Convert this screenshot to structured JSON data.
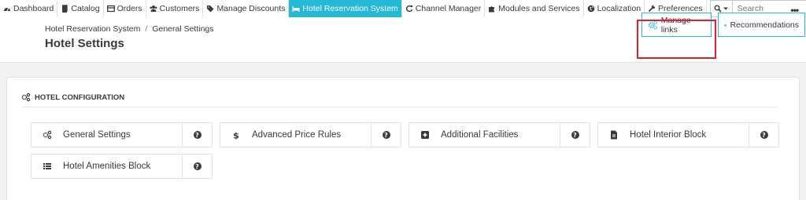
{
  "nav": {
    "items": [
      {
        "label": "Dashboard",
        "icon": "dashboard-icon"
      },
      {
        "label": "Catalog",
        "icon": "book-icon"
      },
      {
        "label": "Orders",
        "icon": "orders-icon"
      },
      {
        "label": "Customers",
        "icon": "users-icon"
      },
      {
        "label": "Manage Discounts",
        "icon": "tag-icon"
      },
      {
        "label": "Hotel Reservation System",
        "icon": "bed-icon",
        "active": true
      },
      {
        "label": "Channel Manager",
        "icon": "refresh-icon"
      },
      {
        "label": "Modules and Services",
        "icon": "puzzle-icon"
      },
      {
        "label": "Localization",
        "icon": "globe-icon"
      },
      {
        "label": "Preferences",
        "icon": "wrench-icon"
      }
    ],
    "search_placeholder": "Search",
    "more_label": "•••"
  },
  "header": {
    "breadcrumb": [
      "Hotel Reservation System",
      "General Settings"
    ],
    "breadcrumb_separator": "/",
    "title": "Hotel Settings",
    "manage_links_label": "Manage links",
    "recommendations_label": "Recommendations"
  },
  "panel": {
    "heading": "HOTEL CONFIGURATION",
    "tiles": [
      {
        "label": "General Settings",
        "icon": "cogs-icon",
        "help": "?"
      },
      {
        "label": "Advanced Price Rules",
        "icon": "dollar-icon",
        "help": "?"
      },
      {
        "label": "Additional Facilities",
        "icon": "plus-square-icon",
        "help": "?"
      },
      {
        "label": "Hotel Interior Block",
        "icon": "file-icon",
        "help": "?"
      },
      {
        "label": "Hotel Amenities Block",
        "icon": "list-icon",
        "help": "?"
      }
    ]
  },
  "colors": {
    "accent": "#25b9d7",
    "highlight": "#e3202a",
    "text": "#363a41"
  }
}
